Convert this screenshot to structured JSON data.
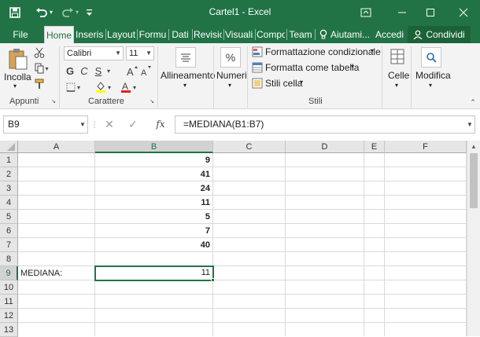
{
  "window": {
    "title": "Cartel1 - Excel"
  },
  "qat": {
    "save_icon": "save-icon",
    "undo_icon": "undo-icon",
    "redo_icon": "redo-icon",
    "customize_icon": "customize-qat-icon"
  },
  "tabs": [
    {
      "label": "File"
    },
    {
      "label": "Home"
    },
    {
      "label": "Inserisc"
    },
    {
      "label": "Layout"
    },
    {
      "label": "Formu"
    },
    {
      "label": "Dati"
    },
    {
      "label": "Revisio"
    },
    {
      "label": "Visualiz"
    },
    {
      "label": "Compo"
    },
    {
      "label": "Team"
    }
  ],
  "tellme": {
    "label": "Aiutami..."
  },
  "account": {
    "signin": "Accedi",
    "share": "Condividi"
  },
  "ribbon": {
    "clipboard": {
      "paste": "Incolla",
      "group": "Appunti"
    },
    "font": {
      "name": "Calibri",
      "size": "11",
      "bold": "G",
      "italic": "C",
      "underline": "S",
      "group": "Carattere"
    },
    "alignment": {
      "label": "Allineamento"
    },
    "number": {
      "label": "Numeri",
      "symbol": "%"
    },
    "styles": {
      "conditional": "Formattazione condizionale",
      "table": "Formatta come tabella",
      "cellstyles": "Stili cella",
      "group": "Stili"
    },
    "cells": {
      "label": "Celle"
    },
    "editing": {
      "label": "Modifica"
    }
  },
  "formula_bar": {
    "name_box": "B9",
    "fx": "fx",
    "formula": "=MEDIANA(B1:B7)"
  },
  "columns": [
    "A",
    "B",
    "C",
    "D",
    "E",
    "F"
  ],
  "rows": [
    "1",
    "2",
    "3",
    "4",
    "5",
    "6",
    "7",
    "8",
    "9",
    "10",
    "11",
    "12",
    "13"
  ],
  "cells": {
    "B1": "9",
    "B2": "41",
    "B3": "24",
    "B4": "11",
    "B5": "5",
    "B6": "7",
    "B7": "40",
    "A9": "MEDIANA:",
    "B9": "11"
  },
  "colors": {
    "accent": "#217346",
    "ribbon": "#f3f3f3"
  }
}
